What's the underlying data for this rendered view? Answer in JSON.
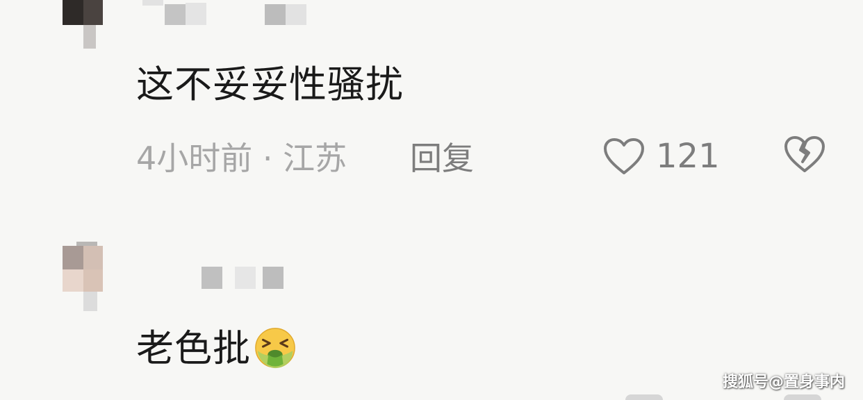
{
  "comments": [
    {
      "text": "这不妥妥性骚扰",
      "time_location": "4小时前 · 江苏",
      "reply_label": "回复",
      "like_count": "121"
    },
    {
      "text": "老色批",
      "emoji": "nauseated-face"
    }
  ],
  "watermark": "搜狐号@置身事内",
  "colors": {
    "background": "#f7f7f5",
    "text": "#1a1a1a",
    "meta": "#a6a6a6",
    "action": "#7d7d7d"
  },
  "icons": [
    "heart-outline-icon",
    "broken-heart-icon",
    "nauseated-face-emoji"
  ]
}
